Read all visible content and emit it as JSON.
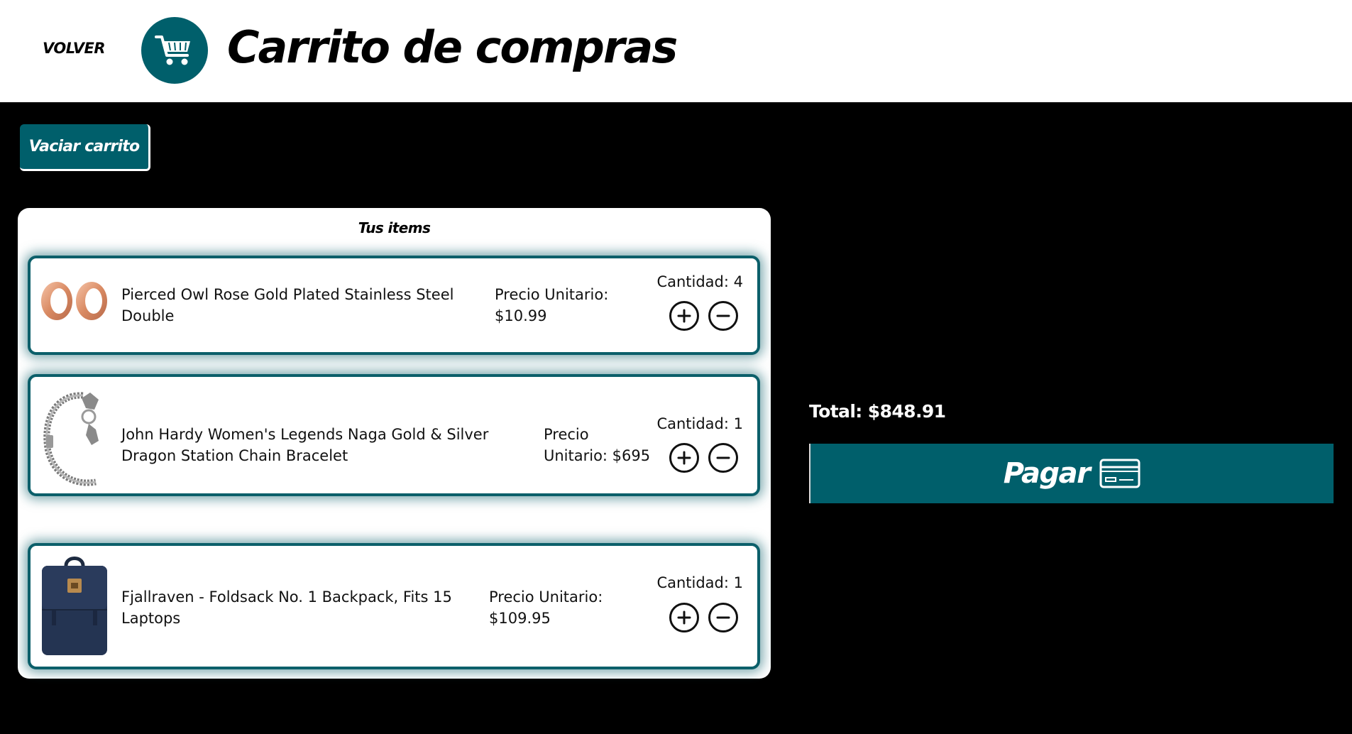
{
  "header": {
    "back_label": "VOLVER",
    "title": "Carrito de compras",
    "cart_icon": "shopping-cart-icon"
  },
  "actions": {
    "empty_cart_label": "Vaciar carrito"
  },
  "items_panel": {
    "title": "Tus items",
    "items": [
      {
        "name_line1": "Pierced Owl Rose Gold Plated Stainless Steel",
        "name_line2": "Double",
        "price_line1": "Precio Unitario:",
        "price_line2": "$10.99",
        "quantity": "Cantidad: 4",
        "image": "rose-gold-earrings-image"
      },
      {
        "name_line1": "John Hardy Women's Legends Naga Gold & Silver",
        "name_line2": "Dragon Station Chain Bracelet",
        "price_line1": "Precio",
        "price_line2": "Unitario: $695",
        "quantity": "Cantidad: 1",
        "image": "chain-bracelet-image"
      },
      {
        "name_line1": "Fjallraven - Foldsack No. 1 Backpack, Fits 15",
        "name_line2": "Laptops",
        "price_line1": "Precio Unitario:",
        "price_line2": "$109.95",
        "quantity": "Cantidad: 1",
        "image": "navy-backpack-image"
      }
    ]
  },
  "summary": {
    "total": "Total: $848.91",
    "pay_label": "Pagar",
    "pay_icon": "credit-card-icon"
  },
  "colors": {
    "accent": "#005f6b",
    "background": "#000000",
    "panel": "#ffffff"
  }
}
